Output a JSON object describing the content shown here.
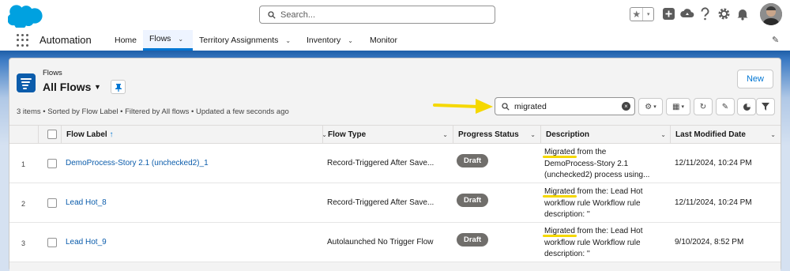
{
  "header": {
    "search_placeholder": "Search...",
    "fav_star": "★",
    "fav_dd": "▾"
  },
  "nav": {
    "app_name": "Automation",
    "items": [
      {
        "label": "Home"
      },
      {
        "label": "Flows"
      },
      {
        "label": "Territory Assignments"
      },
      {
        "label": "Inventory"
      },
      {
        "label": "Monitor"
      }
    ]
  },
  "list_view": {
    "object_label": "Flows",
    "view_name": "All Flows",
    "new_button": "New",
    "meta": "3 items • Sorted by Flow Label • Filtered by All flows • Updated a few seconds ago",
    "search_value": "migrated"
  },
  "table": {
    "columns": [
      {
        "label": "Flow Label",
        "sort": "↑"
      },
      {
        "label": "Flow Type"
      },
      {
        "label": "Progress Status"
      },
      {
        "label": "Description"
      },
      {
        "label": "Last Modified Date"
      }
    ],
    "rows": [
      {
        "num": "1",
        "label": "DemoProcess-Story 2.1 (unchecked2)_1",
        "type": "Record-Triggered After Save...",
        "status": "Draft",
        "desc_hl": "Migrated",
        "desc_rest1": " from the",
        "desc_line2": "DemoProcess-Story 2.1",
        "desc_line3": "(unchecked2) process using...",
        "modified": "12/11/2024, 10:24 PM"
      },
      {
        "num": "2",
        "label": "Lead Hot_8",
        "type": "Record-Triggered After Save...",
        "status": "Draft",
        "desc_hl": "Migrated",
        "desc_rest1": " from the: Lead Hot",
        "desc_line2": "workflow rule Workflow rule",
        "desc_line3": "description: ''",
        "modified": "12/11/2024, 10:24 PM"
      },
      {
        "num": "3",
        "label": "Lead Hot_9",
        "type": "Autolaunched No Trigger Flow",
        "status": "Draft",
        "desc_hl": "Migrated",
        "desc_rest1": " from the: Lead Hot",
        "desc_line2": "workflow rule Workflow rule",
        "desc_line3": "description: ''",
        "modified": "9/10/2024, 8:52 PM"
      }
    ]
  },
  "colors": {
    "brand_blue": "#0176d3",
    "cloud": "#00a1e0",
    "highlight": "#f5d800",
    "arrow": "#f5d800",
    "badge": "#706e6b"
  }
}
